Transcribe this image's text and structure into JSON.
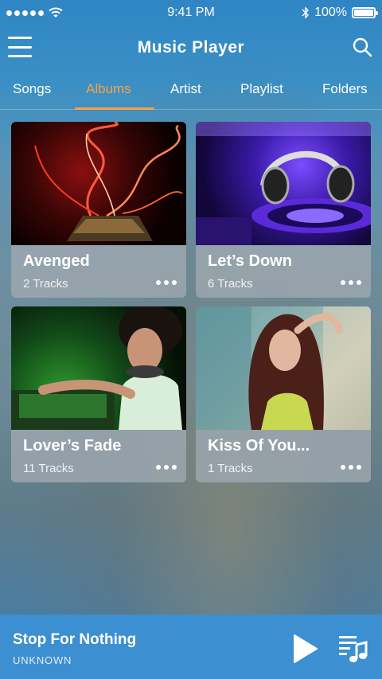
{
  "status_bar": {
    "time": "9:41 PM",
    "battery": "100%"
  },
  "app_bar": {
    "title": "Music Player"
  },
  "tabs": [
    {
      "label": "Songs"
    },
    {
      "label": "Albums",
      "active": true
    },
    {
      "label": "Artist"
    },
    {
      "label": "Playlist"
    },
    {
      "label": "Folders"
    }
  ],
  "albums": [
    {
      "title": "Avenged",
      "tracks": "2 Tracks"
    },
    {
      "title": "Let’s Down",
      "tracks": "6 Tracks"
    },
    {
      "title": "Lover’s Fade",
      "tracks": "11 Tracks"
    },
    {
      "title": "Kiss Of You...",
      "tracks": "1 Tracks"
    }
  ],
  "now_playing": {
    "title": "Stop For Nothing",
    "artist": "UNKNOWN"
  },
  "colors": {
    "accent": "#f3a24a",
    "player_bar": "#3c8fd0"
  },
  "icons": [
    "menu-icon",
    "search-icon",
    "more-icon",
    "play-icon",
    "playlist-icon",
    "wifi-icon",
    "bluetooth-icon",
    "battery-icon"
  ]
}
